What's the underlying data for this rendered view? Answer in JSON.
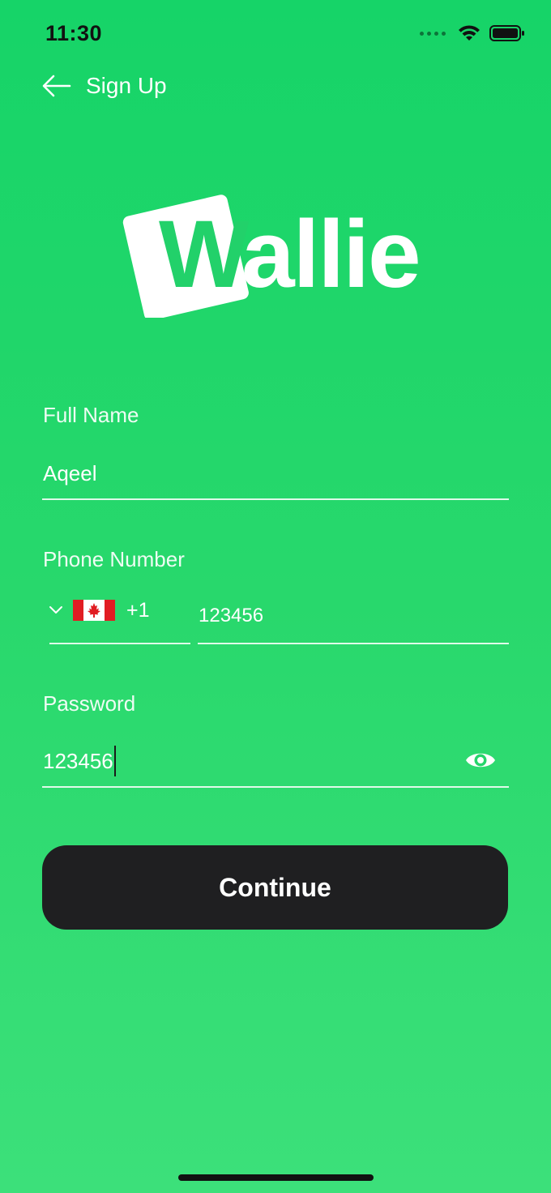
{
  "status_bar": {
    "time": "11:30",
    "icons": [
      "cellular-signal-icon",
      "wifi-icon",
      "battery-icon"
    ]
  },
  "nav": {
    "title": "Sign Up",
    "back_icon": "arrow-left-icon"
  },
  "logo": {
    "text_boxed": "W",
    "text_rest": "allie",
    "icon": "wallie-logo"
  },
  "form": {
    "full_name": {
      "label": "Full Name",
      "value": "Aqeel"
    },
    "phone": {
      "label": "Phone Number",
      "country_flag": "canada-flag-icon",
      "dial_code": "+1",
      "value": "123456"
    },
    "password": {
      "label": "Password",
      "value": "123456",
      "toggle_icon": "eye-icon"
    }
  },
  "continue_label": "Continue",
  "colors": {
    "background_top": "#16d468",
    "background_bottom": "#3ce07a",
    "button": "#1f1f21",
    "text": "#ffffff"
  }
}
